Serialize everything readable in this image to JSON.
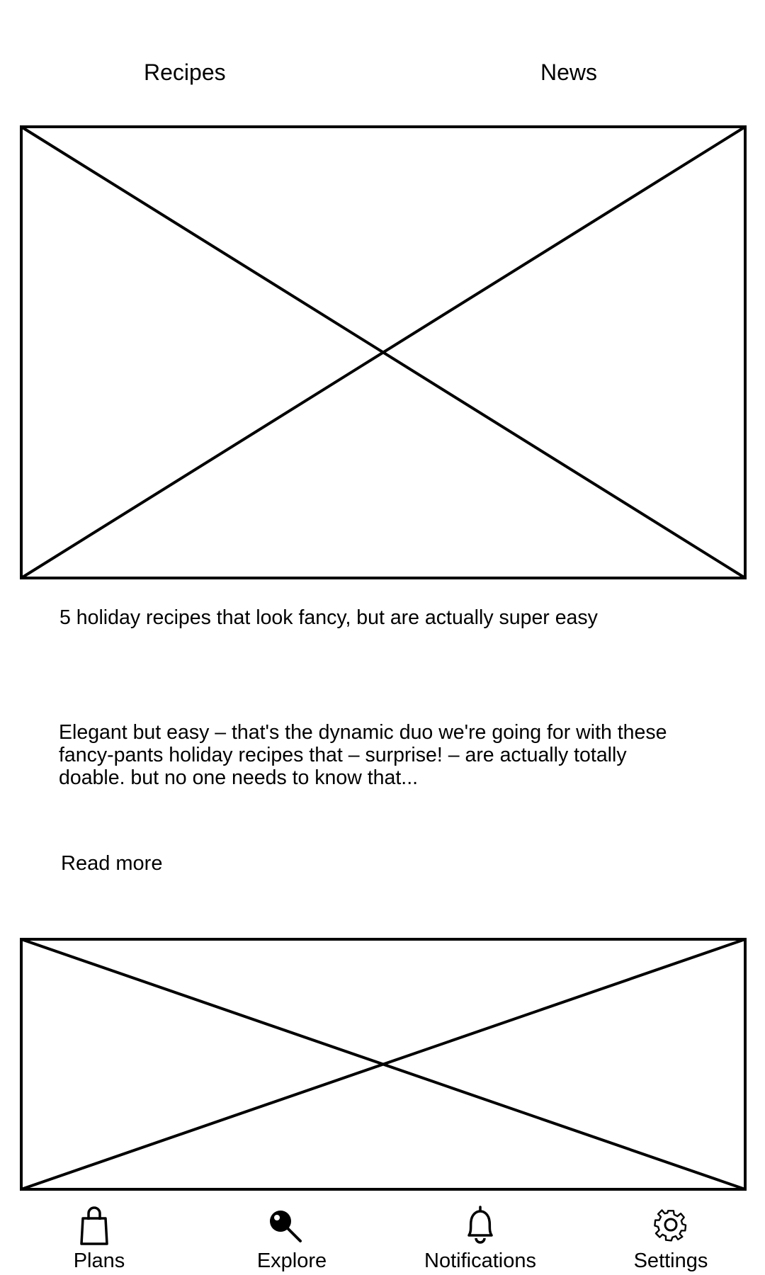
{
  "tabs": {
    "recipes": "Recipes",
    "news": "News"
  },
  "article": {
    "title": "5 holiday recipes that look fancy, but are actually super easy",
    "excerpt": "Elegant but easy – that's the dynamic duo we're going for with these fancy-pants holiday recipes that – surprise! – are actually totally doable. but no one needs to know that...",
    "read_more": "Read more"
  },
  "bottom_nav": {
    "plans": {
      "label": "Plans",
      "icon": "shopping-bag-icon"
    },
    "explore": {
      "label": "Explore",
      "icon": "magnifier-icon"
    },
    "notifications": {
      "label": "Notifications",
      "icon": "bell-icon"
    },
    "settings": {
      "label": "Settings",
      "icon": "gear-icon"
    }
  },
  "colors": {
    "background": "#ffffff",
    "stroke": "#000000"
  }
}
